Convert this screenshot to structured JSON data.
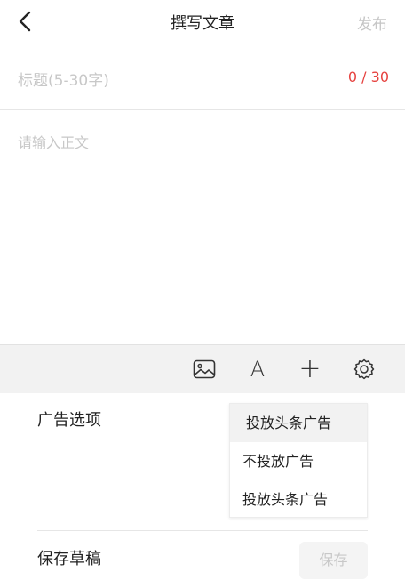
{
  "header": {
    "back_icon": "chevron-left-icon",
    "title": "撰写文章",
    "publish_label": "发布"
  },
  "title_field": {
    "placeholder": "标题(5-30字)",
    "counter": "0 / 30",
    "counter_color": "#e64340"
  },
  "body_field": {
    "placeholder": "请输入正文"
  },
  "toolbar": {
    "icons": [
      "image-icon",
      "font-icon",
      "plus-icon",
      "settings-icon"
    ],
    "font_glyph": "A",
    "plus_glyph": "+"
  },
  "ad_options": {
    "label": "广告选项",
    "selected": "投放头条广告",
    "options": [
      "不投放广告",
      "投放头条广告"
    ]
  },
  "draft": {
    "label": "保存草稿",
    "save_label": "保存"
  }
}
